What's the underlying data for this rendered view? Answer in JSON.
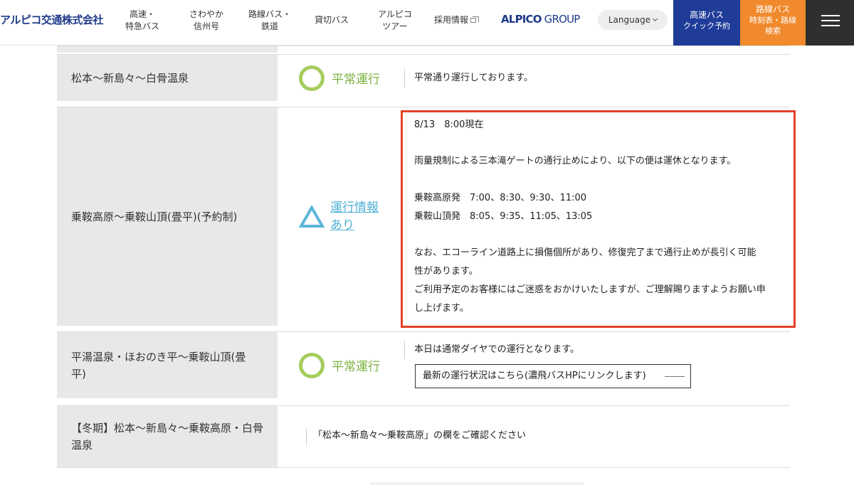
{
  "header": {
    "logo": "アルピコ交通株式会社",
    "nav": [
      {
        "label1": "高速・",
        "label2": "特急バス"
      },
      {
        "label1": "さわやか",
        "label2": "信州号"
      },
      {
        "label1": "路線バス・",
        "label2": "鉄道"
      },
      {
        "label1": "貸切バス",
        "label2": ""
      },
      {
        "label1": "アルピコ",
        "label2": "ツアー"
      },
      {
        "label1": "採用情報",
        "label2": ""
      }
    ],
    "group_logo_bold": "ALPICO",
    "group_logo_thin": " GROUP",
    "language": "Language",
    "quick": {
      "line1": "高速バス",
      "line2": "クイック予約"
    },
    "route": {
      "line1": "路線バス",
      "line2": "時刻表・路線",
      "line3": "検索"
    }
  },
  "rows": [
    {
      "route": "松本〜新島々〜白骨温泉",
      "status": "平常運行",
      "detail": "平常通り運行しております。"
    },
    {
      "route": "乗鞍高原〜乗鞍山頂(畳平)(予約制)",
      "status_link_1": "運行情報",
      "status_link_2": "あり",
      "detail_lines": [
        "8/13　8:00現在",
        "雨量規制による三本滝ゲートの通行止めにより、以下の便は運休となります。",
        "乗鞍高原発　7:00、8:30、9:30、11:00",
        "乗鞍山頂発　8:05、9:35、11:05、13:05",
        "なお、エコーライン道路上に損傷個所があり、修復完了まで通行止めが長引く可能",
        "性があります。",
        "ご利用予定のお客様にはご迷惑をおかけいたしますが、ご理解賜りますようお願い申",
        "し上げます。"
      ]
    },
    {
      "route_1": "平湯温泉・ほおのき平〜乗鞍山頂(畳",
      "route_2": "平)",
      "status": "平常運行",
      "detail": "本日は通常ダイヤでの運行となります。",
      "link": "最新の運行状況はこちら(濃飛バスHPにリンクします)"
    },
    {
      "route_1": "【冬期】松本〜新島々〜乗鞍高原・白骨",
      "route_2": "温泉",
      "detail": "「松本〜新島々〜乗鞍高原」の欄をご確認ください"
    }
  ]
}
